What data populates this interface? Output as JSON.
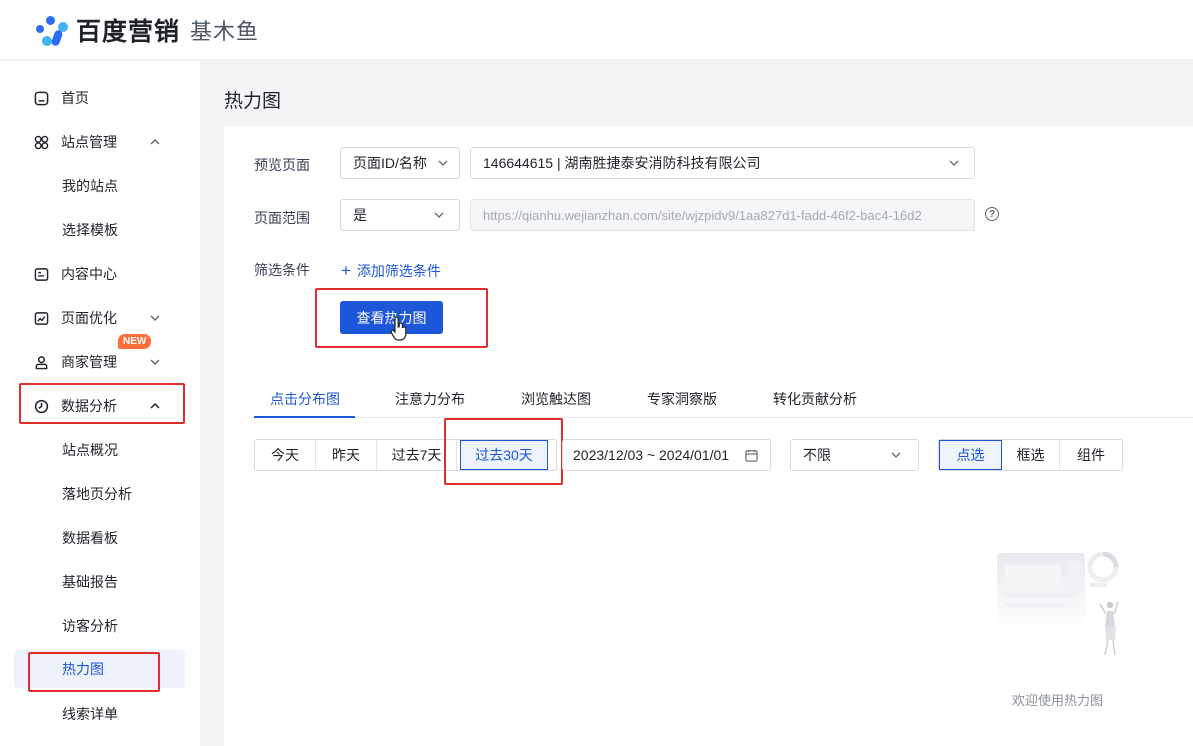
{
  "brand": {
    "name": "百度营销",
    "product": "基木鱼",
    "logo_color": "#2f6cf5"
  },
  "sidebar": {
    "items": [
      {
        "label": "首页",
        "icon": "home-icon"
      },
      {
        "label": "站点管理",
        "icon": "grid-icon"
      },
      {
        "label": "我的站点"
      },
      {
        "label": "选择模板"
      },
      {
        "label": "内容中心",
        "icon": "content-icon"
      },
      {
        "label": "页面优化",
        "icon": "optimize-icon"
      },
      {
        "label": "商家管理",
        "icon": "merchant-icon",
        "badge": "NEW"
      },
      {
        "label": "数据分析",
        "icon": "analytics-icon"
      },
      {
        "label": "站点概况"
      },
      {
        "label": "落地页分析"
      },
      {
        "label": "数据看板"
      },
      {
        "label": "基础报告"
      },
      {
        "label": "访客分析"
      },
      {
        "label": "热力图",
        "active": true
      },
      {
        "label": "线索详单"
      }
    ]
  },
  "page": {
    "title": "热力图"
  },
  "form": {
    "preview_label": "预览页面",
    "preview_type": "页面ID/名称",
    "preview_value": "146644615 | 湖南胜捷泰安消防科技有限公司",
    "scope_label": "页面范围",
    "scope_value": "是",
    "scope_url": "https://qianhu.wejianzhan.com/site/wjzpidv9/1aa827d1-fadd-46f2-bac4-16d2",
    "filter_label": "筛选条件",
    "add_filter": "添加筛选条件",
    "view_button": "查看热力图"
  },
  "tabs": [
    "点击分布图",
    "注意力分布",
    "浏览触达图",
    "专家洞察版",
    "转化贡献分析"
  ],
  "active_tab": "点击分布图",
  "range_options": [
    "今天",
    "昨天",
    "过去7天",
    "过去30天"
  ],
  "range_selected": "过去30天",
  "date_range": "2023/12/03 ~ 2024/01/01",
  "device_select": "不限",
  "mode_options": [
    "点选",
    "框选",
    "组件"
  ],
  "mode_selected": "点选",
  "empty_text": "欢迎使用热力图",
  "colors": {
    "primary": "#1d56d8",
    "highlight": "#e32d2d",
    "badge": "#ff6d3a"
  }
}
